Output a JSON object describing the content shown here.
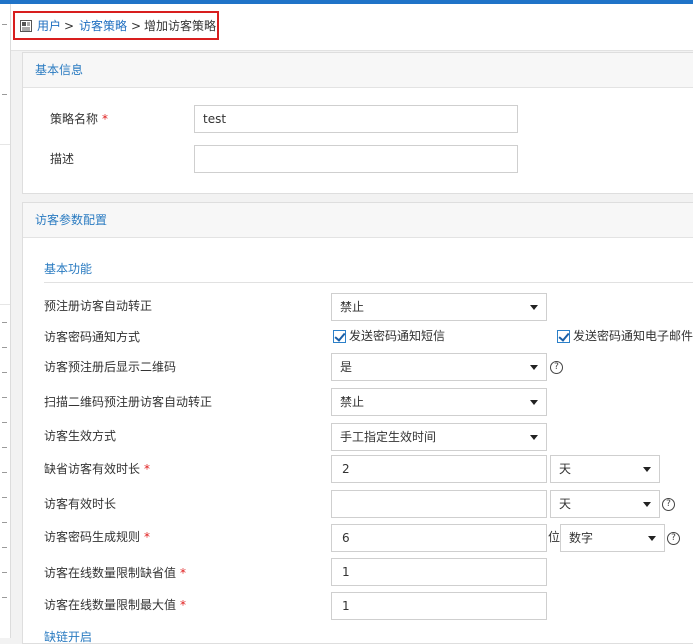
{
  "breadcrumb": {
    "items": [
      "用户",
      "访客策略",
      "增加访客策略"
    ],
    "separator": ">"
  },
  "basic_info": {
    "title": "基本信息",
    "fields": {
      "policy_name": {
        "label": "策略名称",
        "value": "test"
      },
      "description": {
        "label": "描述",
        "value": ""
      }
    }
  },
  "visitor_config": {
    "title": "访客参数配置",
    "section_basic": "基本功能",
    "section_next": "缺链开启",
    "rows": {
      "prereg_auto_convert": {
        "label": "预注册访客自动转正",
        "value": "禁止"
      },
      "pwd_notify_method": {
        "label": "访客密码通知方式",
        "option_sms": "发送密码通知短信",
        "option_email": "发送密码通知电子邮件",
        "sms_checked": true,
        "email_checked": true
      },
      "prereg_show_qr": {
        "label": "访客预注册后显示二维码",
        "value": "是"
      },
      "scan_qr_auto_convert": {
        "label": "扫描二维码预注册访客自动转正",
        "value": "禁止"
      },
      "effective_method": {
        "label": "访客生效方式",
        "value": "手工指定生效时间"
      },
      "default_validity": {
        "label": "缺省访客有效时长",
        "value": "2",
        "unit": "天"
      },
      "validity": {
        "label": "访客有效时长",
        "value": "",
        "unit": "天"
      },
      "pwd_rule": {
        "label": "访客密码生成规则",
        "value": "6",
        "suffix": "位",
        "type": "数字"
      },
      "online_default": {
        "label": "访客在线数量限制缺省值",
        "value": "1"
      },
      "online_max": {
        "label": "访客在线数量限制最大值",
        "value": "1"
      }
    },
    "required_mark": "*",
    "help_glyph": "?"
  },
  "colors": {
    "accent": "#2a7bc1",
    "link": "#1f6fc0",
    "required": "#e02020",
    "highlight_box": "#d81e1e",
    "topbar": "#1f73c8"
  }
}
